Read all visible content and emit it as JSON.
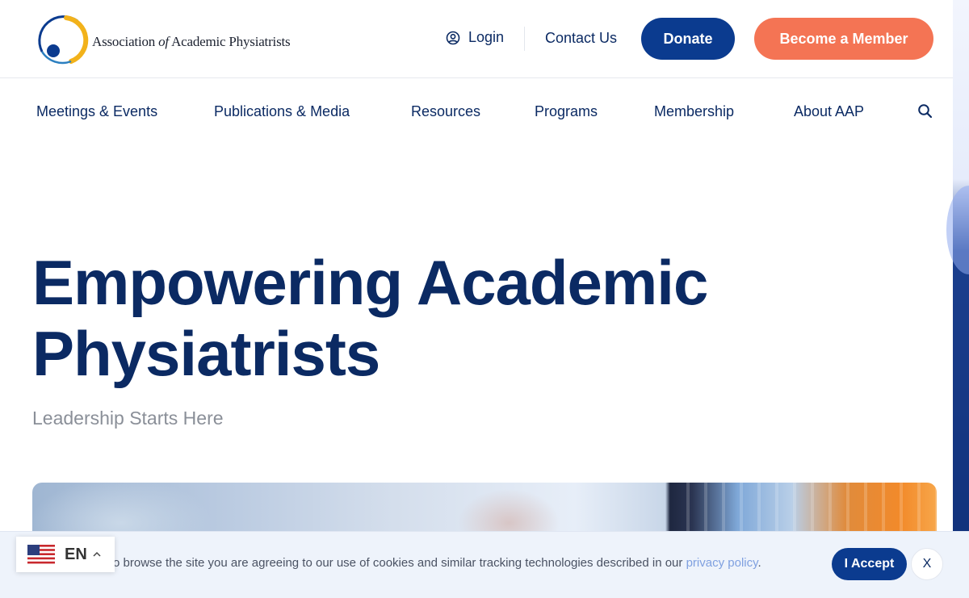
{
  "header": {
    "logo_text_pre": "Association ",
    "logo_text_of": "of",
    "logo_text_post": " Academic Physiatrists",
    "login_label": "Login",
    "contact_label": "Contact Us",
    "donate_label": "Donate",
    "member_label": "Become a Member"
  },
  "nav": {
    "items": [
      {
        "label": "Meetings & Events"
      },
      {
        "label": "Publications & Media"
      },
      {
        "label": "Resources"
      },
      {
        "label": "Programs"
      },
      {
        "label": "Membership"
      },
      {
        "label": "About AAP"
      }
    ]
  },
  "hero": {
    "title_line1": "Empowering Academic",
    "title_line2": "Physiatrists",
    "subtitle": "Leadership Starts Here"
  },
  "cookie": {
    "text": "o browse the site you are agreeing to our use of cookies and similar tracking technologies described in our ",
    "link_text": "privacy policy",
    "text_end": ".",
    "accept_label": "I Accept",
    "close_label": "X"
  },
  "language": {
    "code": "EN"
  },
  "colors": {
    "navy": "#0b2a63",
    "donate": "#0b3b8f",
    "member": "#f47454",
    "link": "#7fa0e0"
  }
}
